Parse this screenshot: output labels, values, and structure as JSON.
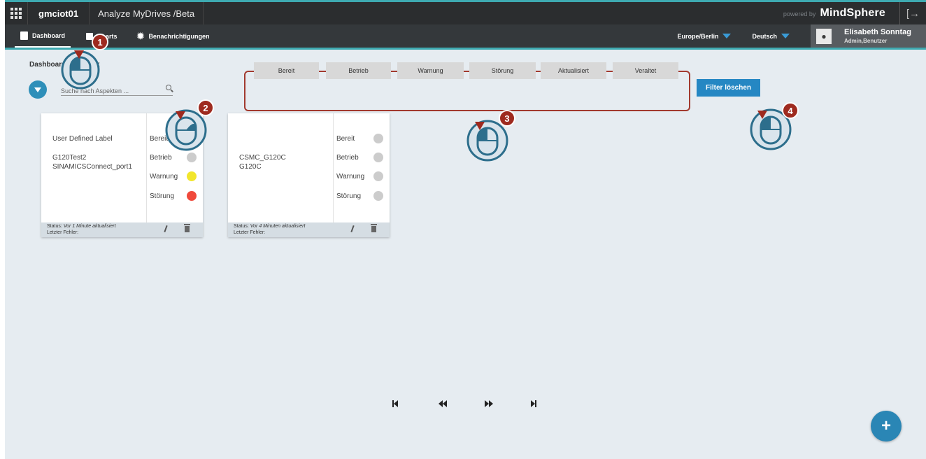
{
  "topbar": {
    "tenant": "gmciot01",
    "app_name": "Analyze MyDrives /Beta",
    "powered_by": "powered by",
    "brand": "MindSphere",
    "logout_icon": "logout-icon"
  },
  "nav": {
    "dashboard": "Dashboard",
    "charts": "Charts",
    "notifications": "Benachrichtigungen",
    "timezone": "Europe/Berlin",
    "language": "Deutsch",
    "user_name": "Elisabeth Sonntag",
    "user_role": "Admin,Benutzer"
  },
  "main": {
    "breadcrumb": "Dashboard Überblick",
    "search_placeholder": "Suche nach Aspekten ...",
    "filters": [
      "Bereit",
      "Betrieb",
      "Warnung",
      "Störung",
      "Aktualisiert",
      "Veraltet"
    ],
    "clear_filter": "Filter löschen"
  },
  "cards": [
    {
      "label": "User Defined Label",
      "name": "G120Test2",
      "model": "SINAMICSConnect_port1",
      "statuses": [
        {
          "label": "Bereit",
          "color": "#cccccc"
        },
        {
          "label": "Betrieb",
          "color": "#cccccc"
        },
        {
          "label": "Warnung",
          "color": "#f2e62c"
        },
        {
          "label": "Störung",
          "color": "#f0493b"
        }
      ],
      "status_prefix": "Status: ",
      "status_text": "Vor 1 Minute aktualisiert",
      "last_error": "Letzter Fehler:"
    },
    {
      "label": "",
      "name": "CSMC_G120C",
      "model": "G120C",
      "statuses": [
        {
          "label": "Bereit",
          "color": "#cccccc"
        },
        {
          "label": "Betrieb",
          "color": "#cccccc"
        },
        {
          "label": "Warnung",
          "color": "#cccccc"
        },
        {
          "label": "Störung",
          "color": "#cccccc"
        }
      ],
      "status_prefix": "Status: ",
      "status_text": "Vor 4 Minuten aktualisiert",
      "last_error": "Letzter Fehler:"
    }
  ],
  "callouts": [
    "1",
    "2",
    "3",
    "4"
  ],
  "colors": {
    "accent": "#3eaab1",
    "primary_button": "#2587c3",
    "callout_number": "#9e2a1f",
    "callout_ring": "#2d6e8c",
    "highlight_box": "#a23a2f"
  }
}
